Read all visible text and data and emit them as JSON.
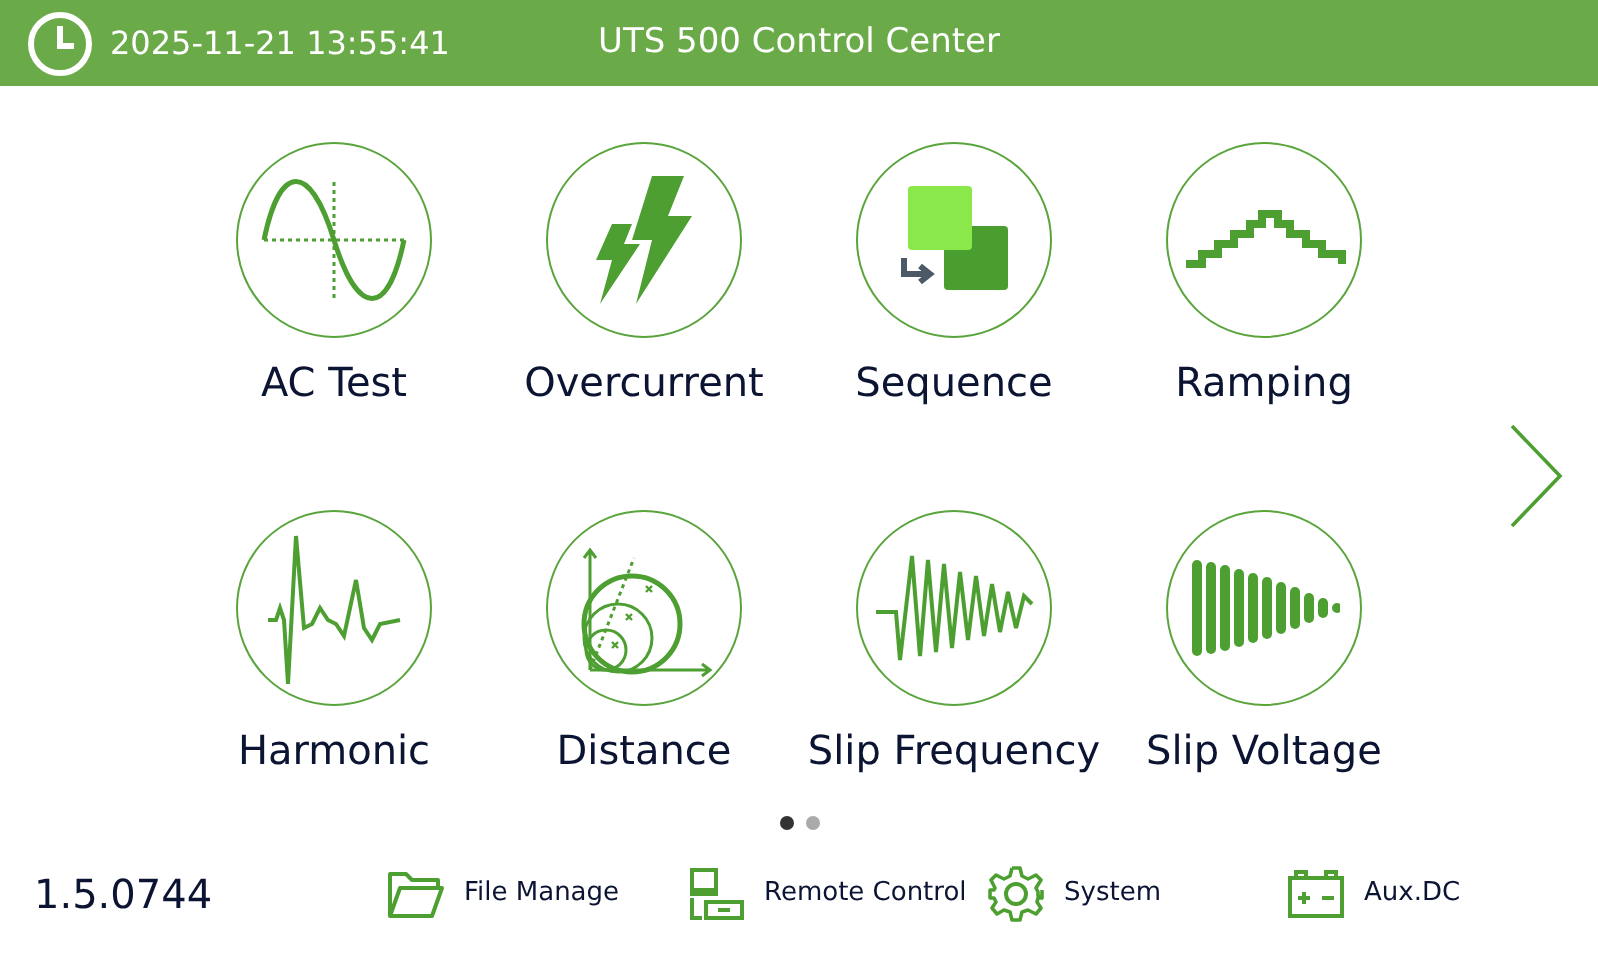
{
  "header": {
    "datetime": "2025-11-21 13:55:41",
    "title": "UTS 500 Control Center"
  },
  "tiles": [
    {
      "kind": "sine",
      "label": "AC Test"
    },
    {
      "kind": "bolts",
      "label": "Overcurrent"
    },
    {
      "kind": "sequence",
      "label": "Sequence"
    },
    {
      "kind": "steps",
      "label": "Ramping"
    },
    {
      "kind": "harmonic",
      "label": "Harmonic"
    },
    {
      "kind": "distance",
      "label": "Distance"
    },
    {
      "kind": "chirp",
      "label": "Slip Frequency"
    },
    {
      "kind": "bars",
      "label": "Slip Voltage"
    }
  ],
  "pages": [
    {
      "selected": true
    },
    {
      "selected": false
    }
  ],
  "version": "1.5.0744",
  "toolbar": [
    {
      "kind": "folder",
      "label": "File Manage"
    },
    {
      "kind": "remote",
      "label": "Remote Control"
    },
    {
      "kind": "gear",
      "label": "System"
    },
    {
      "kind": "battery",
      "label": "Aux.DC"
    }
  ]
}
